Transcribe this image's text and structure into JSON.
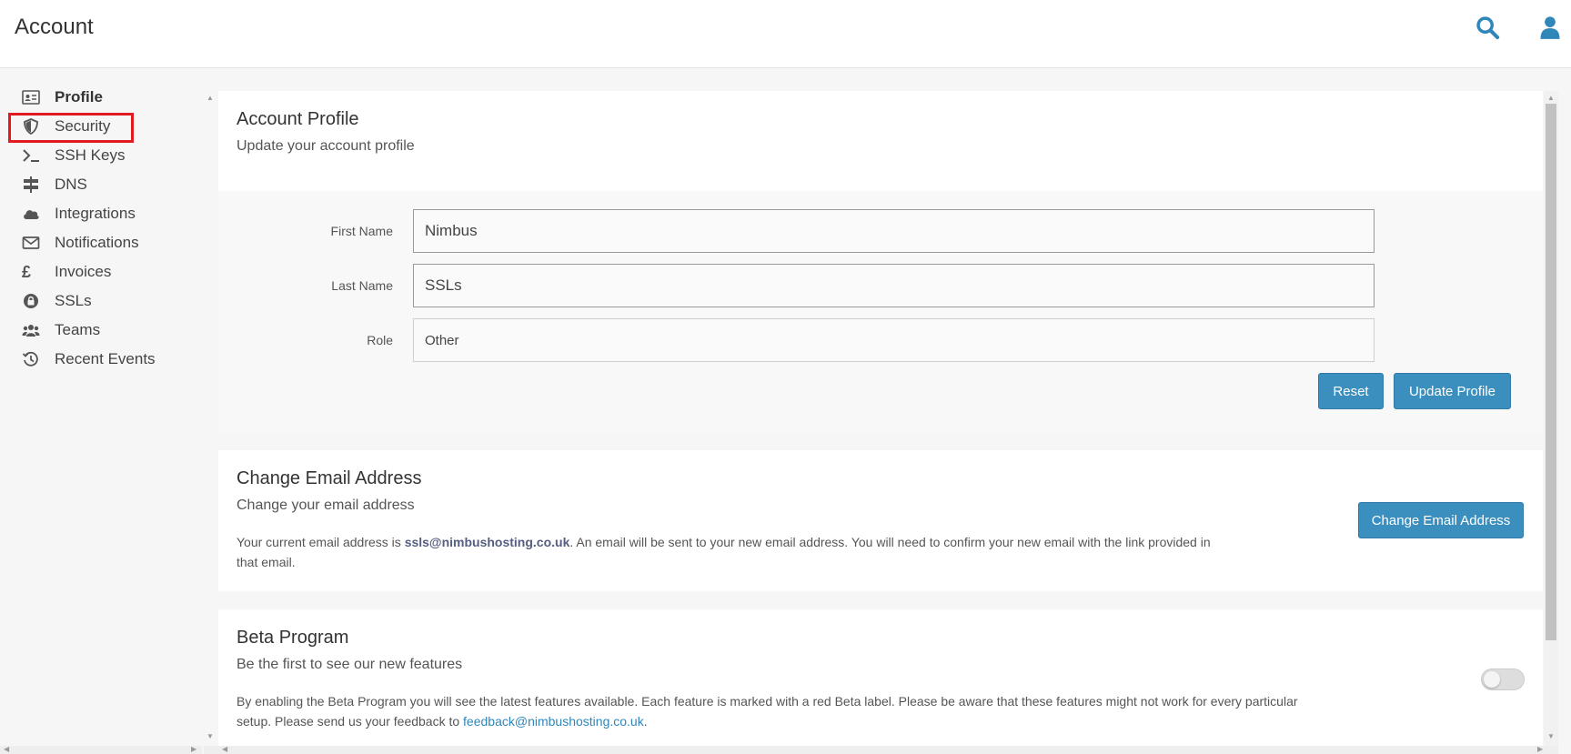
{
  "header": {
    "title": "Account",
    "search_icon": "search-icon",
    "user_icon": "user-icon"
  },
  "colors": {
    "accent": "#3b8fbf",
    "highlight": "#e11b22",
    "link": "#2f86b8"
  },
  "sidebar": {
    "items": [
      {
        "label": "Profile",
        "icon": "id-card-icon"
      },
      {
        "label": "Security",
        "icon": "shield-icon"
      },
      {
        "label": "SSH Keys",
        "icon": "terminal-icon"
      },
      {
        "label": "DNS",
        "icon": "signpost-icon"
      },
      {
        "label": "Integrations",
        "icon": "cloud-icon"
      },
      {
        "label": "Notifications",
        "icon": "envelope-icon"
      },
      {
        "label": "Invoices",
        "icon": "pound-icon"
      },
      {
        "label": "SSLs",
        "icon": "lock-badge-icon"
      },
      {
        "label": "Teams",
        "icon": "users-icon"
      },
      {
        "label": "Recent Events",
        "icon": "history-icon"
      }
    ]
  },
  "profile": {
    "title": "Account Profile",
    "subtitle": "Update your account profile",
    "first_name_label": "First Name",
    "first_name_value": "Nimbus",
    "last_name_label": "Last Name",
    "last_name_value": "SSLs",
    "role_label": "Role",
    "role_value": "Other",
    "reset_label": "Reset",
    "update_label": "Update Profile"
  },
  "email": {
    "title": "Change Email Address",
    "subtitle": "Change your email address",
    "text_before": "Your current email address is ",
    "address": "ssls@nimbushosting.co.uk",
    "text_after": ". An email will be sent to your new email address. You will need to confirm your new email with the link provided in that email.",
    "button_label": "Change Email Address"
  },
  "beta": {
    "title": "Beta Program",
    "subtitle": "Be the first to see our new features",
    "text_before": "By enabling the Beta Program you will see the latest features available. Each feature is marked with a red Beta label. Please be aware that these features might not work for every particular setup. Please send us your feedback to ",
    "feedback_email": "feedback@nimbushosting.co.uk",
    "text_after": ".",
    "enabled": false
  }
}
